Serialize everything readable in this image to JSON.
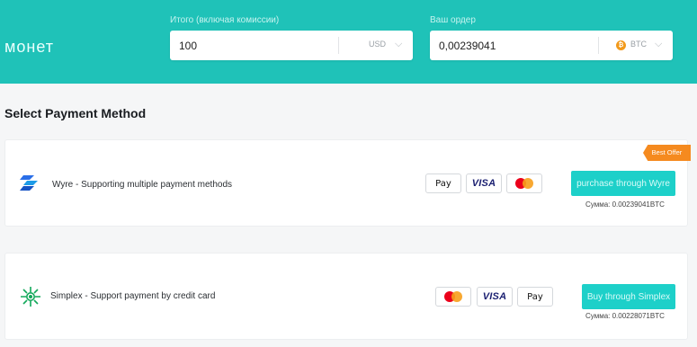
{
  "header": {
    "brand": "монет",
    "total_label": "Итого (включая комиссии)",
    "total_value": "100",
    "total_currency": "USD",
    "order_label": "Ваш ордер",
    "order_value": "0,00239041",
    "order_currency": "BTC"
  },
  "section_title": "Select Payment Method",
  "providers": [
    {
      "name": "Wyre - Supporting multiple payment methods",
      "badge": "Best Offer",
      "payment_methods": [
        "Apple Pay",
        "VISA",
        "Mastercard"
      ],
      "apple_pay_label": "Pay",
      "visa_label": "VISA",
      "button_label": "purchase through Wyre",
      "sum_label": "Сумма:",
      "sum_value": "0.00239041BTC",
      "icon": "wyre-logo-icon"
    },
    {
      "name": "Simplex - Support payment by credit card",
      "payment_methods": [
        "Mastercard",
        "VISA",
        "Apple Pay"
      ],
      "apple_pay_label": "Pay",
      "visa_label": "VISA",
      "button_label": "Buy through Simplex",
      "sum_label": "Сумма:",
      "sum_value": "0.00228071BTC",
      "icon": "simplex-logo-icon"
    }
  ],
  "colors": {
    "header_bg": "#1fc2b8",
    "button_bg": "#1dd0c9",
    "badge_bg": "#f58a1f",
    "page_bg": "#f5f6f7"
  }
}
